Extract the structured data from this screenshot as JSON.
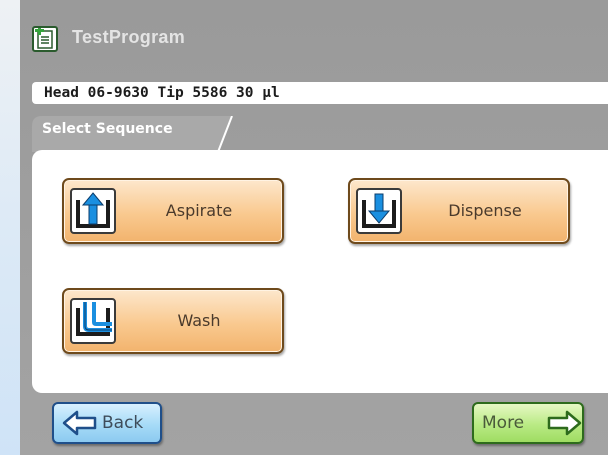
{
  "header": {
    "title": "TestProgram",
    "icon": "program-document-icon"
  },
  "info_bar": {
    "text": "Head 06-9630  Tip 5586 30 µl"
  },
  "section": {
    "label": "Select Sequence"
  },
  "sequences": [
    {
      "label": "Aspirate",
      "icon": "aspirate-icon"
    },
    {
      "label": "Dispense",
      "icon": "dispense-icon"
    },
    {
      "label": "Wash",
      "icon": "wash-icon"
    }
  ],
  "footer": {
    "back_label": "Back",
    "more_label": "More"
  },
  "colors": {
    "sequence_button": "#f9c98f",
    "back_button": "#a6dbf7",
    "more_button": "#b9ea84",
    "icon_arrow": "#1a8fe0"
  }
}
